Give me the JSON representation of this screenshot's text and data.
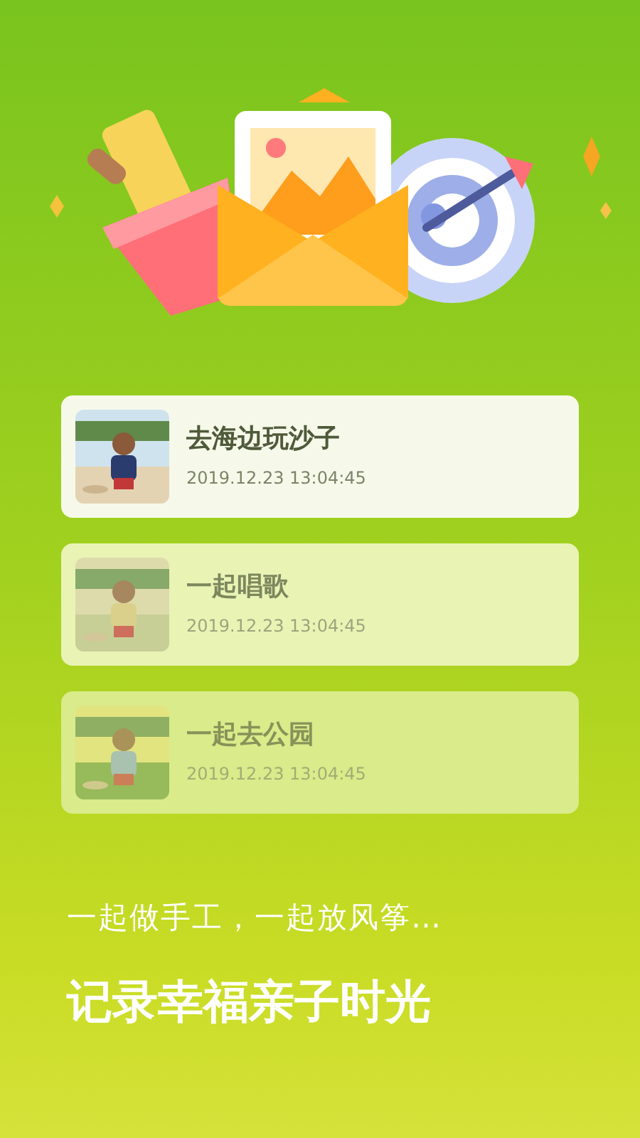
{
  "records": [
    {
      "title": "去海边玩沙子",
      "time": "2019.12.23 13:04:45",
      "kind": "primary"
    },
    {
      "title": "一起唱歌",
      "time": "2019.12.23 13:04:45",
      "kind": "secondary"
    },
    {
      "title": "一起去公园",
      "time": "2019.12.23 13:04:45",
      "kind": "tertiary"
    }
  ],
  "subtitle": "一起做手工，一起放风筝…",
  "headline": "记录幸福亲子时光"
}
